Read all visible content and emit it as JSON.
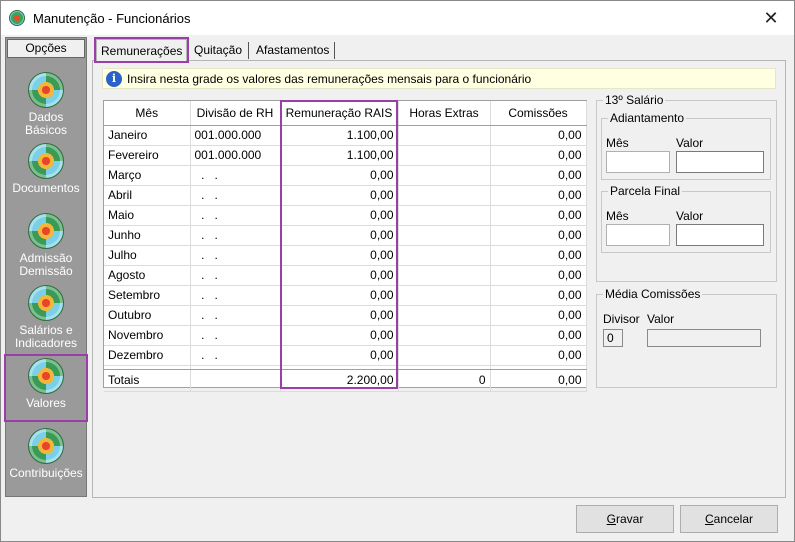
{
  "window": {
    "title": "Manutenção - Funcionários",
    "close_glyph": "✕"
  },
  "sidebar": {
    "header": "Opções",
    "items": [
      {
        "label1": "Dados",
        "label2": "Básicos",
        "icon": "dados-basicos-icon"
      },
      {
        "label1": "Documentos",
        "label2": "",
        "icon": "documentos-icon"
      },
      {
        "label1": "Admissão",
        "label2": "Demissão",
        "icon": "admissao-icon"
      },
      {
        "label1": "Salários e",
        "label2": "Indicadores",
        "icon": "salarios-icon"
      },
      {
        "label1": "Valores",
        "label2": "",
        "icon": "valores-icon"
      },
      {
        "label1": "Contribuições",
        "label2": "",
        "icon": "contribuicoes-icon"
      }
    ]
  },
  "tabs": [
    "Remunerações",
    "Quitação",
    "Afastamentos"
  ],
  "info": {
    "icon_glyph": "i",
    "text": "Insira nesta grade os valores das remunerações mensais para o funcionário"
  },
  "grid": {
    "headers": [
      "Mês",
      "Divisão de RH",
      "Remuneração RAIS",
      "Horas Extras",
      "Comissões"
    ],
    "rows": [
      {
        "mes": "Janeiro",
        "divisao": "001.000.000",
        "rais": "1.100,00",
        "horas": "",
        "comissoes": "0,00"
      },
      {
        "mes": "Fevereiro",
        "divisao": "001.000.000",
        "rais": "1.100,00",
        "horas": "",
        "comissoes": "0,00"
      },
      {
        "mes": "Março",
        "divisao": "  .   .",
        "rais": "0,00",
        "horas": "",
        "comissoes": "0,00"
      },
      {
        "mes": "Abril",
        "divisao": "  .   .",
        "rais": "0,00",
        "horas": "",
        "comissoes": "0,00"
      },
      {
        "mes": "Maio",
        "divisao": "  .   .",
        "rais": "0,00",
        "horas": "",
        "comissoes": "0,00"
      },
      {
        "mes": "Junho",
        "divisao": "  .   .",
        "rais": "0,00",
        "horas": "",
        "comissoes": "0,00"
      },
      {
        "mes": "Julho",
        "divisao": "  .   .",
        "rais": "0,00",
        "horas": "",
        "comissoes": "0,00"
      },
      {
        "mes": "Agosto",
        "divisao": "  .   .",
        "rais": "0,00",
        "horas": "",
        "comissoes": "0,00"
      },
      {
        "mes": "Setembro",
        "divisao": "  .   .",
        "rais": "0,00",
        "horas": "",
        "comissoes": "0,00"
      },
      {
        "mes": "Outubro",
        "divisao": "  .   .",
        "rais": "0,00",
        "horas": "",
        "comissoes": "0,00"
      },
      {
        "mes": "Novembro",
        "divisao": "  .   .",
        "rais": "0,00",
        "horas": "",
        "comissoes": "0,00"
      },
      {
        "mes": "Dezembro",
        "divisao": "  .   .",
        "rais": "0,00",
        "horas": "",
        "comissoes": "0,00"
      }
    ],
    "totals": {
      "label": "Totais",
      "rais": "2.200,00",
      "horas": "0",
      "comissoes": "0,00"
    }
  },
  "decimo_terceiro": {
    "title": "13º Salário",
    "adiantamento": {
      "title": "Adiantamento",
      "mes_label": "Mês",
      "valor_label": "Valor",
      "mes_value": "",
      "valor_value": ""
    },
    "parcela_final": {
      "title": "Parcela Final",
      "mes_label": "Mês",
      "valor_label": "Valor",
      "mes_value": "",
      "valor_value": ""
    }
  },
  "media_comissoes": {
    "title": "Média Comissões",
    "divisor_label": "Divisor",
    "valor_label": "Valor",
    "divisor_value": "0",
    "valor_value": ""
  },
  "buttons": {
    "gravar_first": "G",
    "gravar_rest": "ravar",
    "cancelar_first": "C",
    "cancelar_rest": "ancelar"
  },
  "colors": {
    "highlight": "#9b3fa8",
    "sidebar": "#9a9a9a",
    "info_bg": "#ffffe1"
  }
}
